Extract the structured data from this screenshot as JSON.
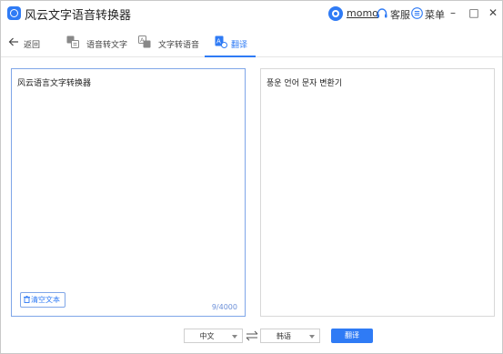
{
  "window": {
    "title": "风云文字语音转换器",
    "username": "momo",
    "service_label": "客服",
    "menu_label": "菜单",
    "controls": {
      "minimize": "–",
      "maximize": "□",
      "close": "✕"
    }
  },
  "nav": {
    "back_label": "返回",
    "tabs": [
      {
        "label": "语音转文字",
        "icon": "speech-to-text-icon",
        "active": false
      },
      {
        "label": "文字转语音",
        "icon": "text-to-speech-icon",
        "active": false
      },
      {
        "label": "翻译",
        "icon": "translate-icon",
        "active": true
      }
    ]
  },
  "editor": {
    "source_text": "风云语言文字转换器",
    "target_text": "풍운 언어 문자 변환기",
    "clear_label": "清空文本",
    "char_count": "9/4000"
  },
  "controls": {
    "source_lang": "中文",
    "target_lang": "韩语",
    "translate_label": "翻译"
  },
  "colors": {
    "accent": "#2f7bf5",
    "border_active": "#7fa6e8"
  }
}
